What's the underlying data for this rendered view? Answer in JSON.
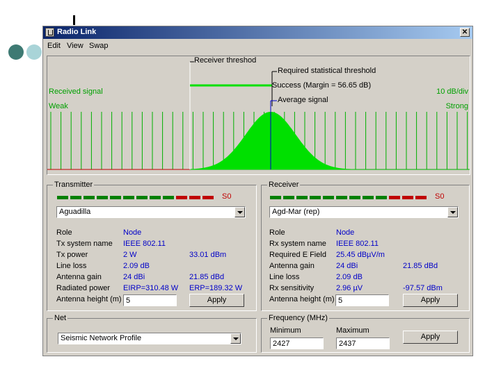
{
  "window": {
    "title": "Radio Link",
    "close_glyph": "✕"
  },
  "menu": [
    "Edit",
    "View",
    "Swap"
  ],
  "graph": {
    "receiver_threshold": "Receiver threshod",
    "required_threshold": "Required statistical threshold",
    "success": "Success (Margin = 56.65 dB)",
    "average_signal": "Average signal",
    "received_signal": "Received signal",
    "weak": "Weak",
    "scale": "10 dB/div",
    "strong": "Strong",
    "colors": {
      "signal": "#00e000",
      "threshold_red": "#c00000",
      "grid": "#00b000"
    }
  },
  "transmitter": {
    "legend": "Transmitter",
    "level": "S0",
    "site": "Aguadilla",
    "rows": [
      {
        "label": "Role",
        "value": "Node",
        "extra": ""
      },
      {
        "label": "Tx system name",
        "value": "IEEE 802.11",
        "extra": ""
      },
      {
        "label": "Tx power",
        "value": "2 W",
        "extra": "33.01 dBm"
      },
      {
        "label": "Line loss",
        "value": "2.09 dB",
        "extra": ""
      },
      {
        "label": "Antenna gain",
        "value": "24 dBi",
        "extra": "21.85 dBd"
      },
      {
        "label": "Radiated power",
        "value": "EIRP=310.48 W",
        "extra": "ERP=189.32 W"
      }
    ],
    "antenna_label": "Antenna height (m)",
    "antenna_value": "5",
    "apply": "Apply"
  },
  "receiver": {
    "legend": "Receiver",
    "level": "S0",
    "site": "Agd-Mar (rep)",
    "rows": [
      {
        "label": "Role",
        "value": "Node",
        "extra": ""
      },
      {
        "label": "Rx system name",
        "value": "IEEE 802.11",
        "extra": ""
      },
      {
        "label": "Required E Field",
        "value": "25.45 dBµV/m",
        "extra": ""
      },
      {
        "label": "Antenna gain",
        "value": "24 dBi",
        "extra": "21.85 dBd"
      },
      {
        "label": "Line loss",
        "value": "2.09 dB",
        "extra": ""
      },
      {
        "label": "Rx sensitivity",
        "value": "2.96 µV",
        "extra": "-97.57 dBm"
      }
    ],
    "antenna_label": "Antenna height (m)",
    "antenna_value": "5",
    "apply": "Apply"
  },
  "net": {
    "legend": "Net",
    "profile": "Seismic Network Profile"
  },
  "frequency": {
    "legend": "Frequency (MHz)",
    "min_label": "Minimum",
    "max_label": "Maximum",
    "min_value": "2427",
    "max_value": "2437",
    "apply": "Apply"
  }
}
